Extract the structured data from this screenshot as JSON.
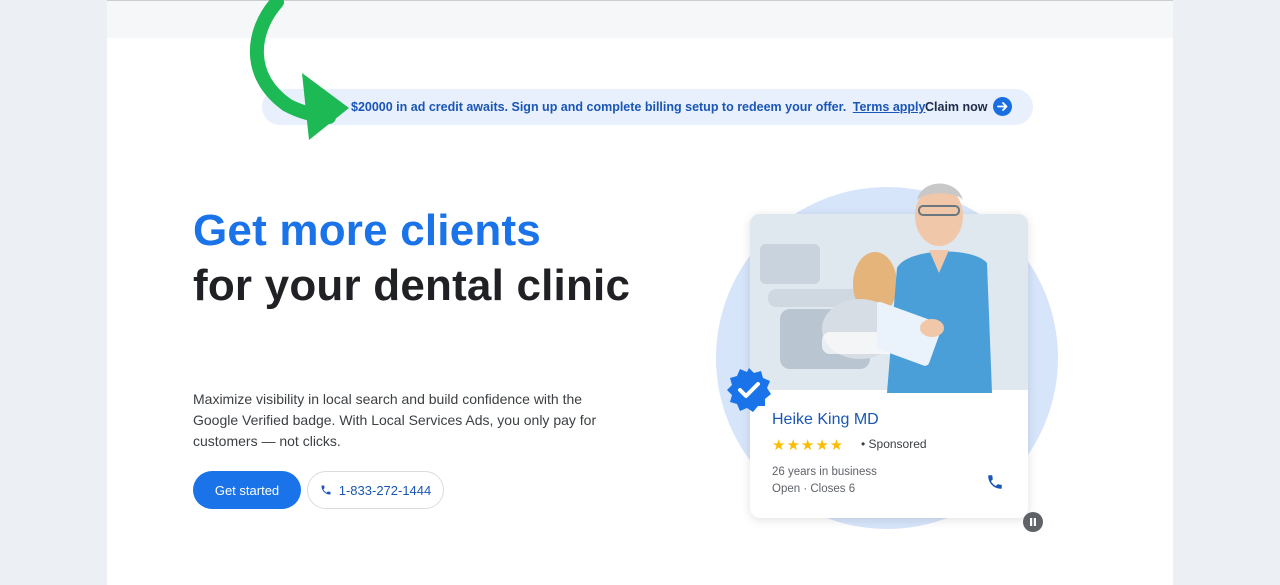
{
  "promo": {
    "message": "$20000 in ad credit awaits. Sign up and complete billing setup to redeem your offer.",
    "terms_link": "Terms apply",
    "period": ".",
    "claim_label": "Claim now"
  },
  "hero": {
    "headline_line1": "Get more clients",
    "headline_line2": "for your dental clinic",
    "description": "Maximize visibility in local search and build confidence with the Google Verified badge. With Local Services Ads, you only pay for customers — not clicks.",
    "primary_button": "Get started",
    "phone_button": "1-833-272-1444"
  },
  "card": {
    "name": "Heike King MD",
    "rating_stars": 5,
    "stars_text": "★★★★★",
    "sponsored": "• Sponsored",
    "years": "26 years in business",
    "hours": "Open · Closes 6"
  },
  "colors": {
    "accent": "#1a73e8",
    "promo_bg": "#e8f0fd",
    "annotation_arrow": "#1db954",
    "star": "#fbbc04"
  },
  "icons": {
    "annotation": "green-curved-arrow-icon",
    "claim": "arrow-right-circle-icon",
    "phone": "phone-icon",
    "verified": "verified-badge-icon",
    "pause": "pause-icon"
  }
}
